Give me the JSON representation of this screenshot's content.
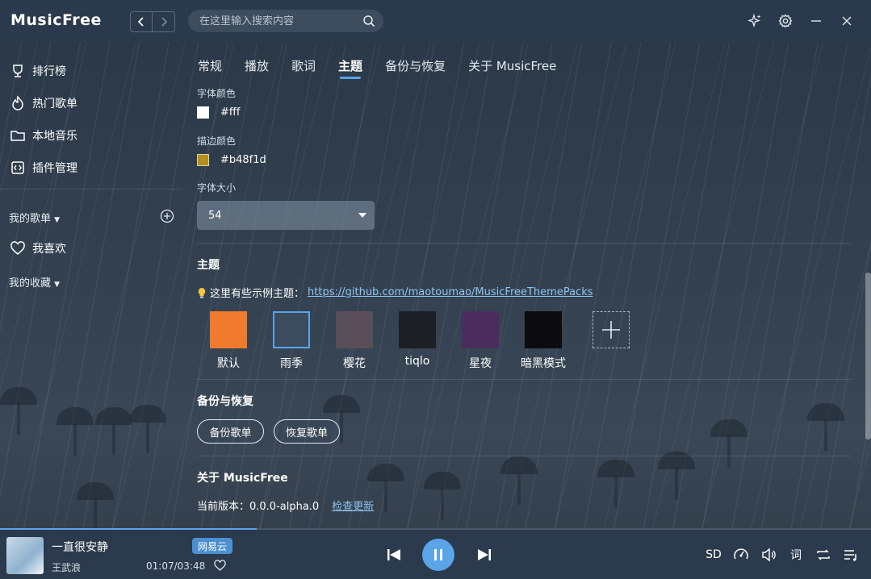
{
  "app": {
    "name": "MusicFree"
  },
  "search": {
    "placeholder": "在这里输入搜索内容"
  },
  "sidebar": {
    "items": [
      {
        "label": "排行榜",
        "icon": "trophy-icon"
      },
      {
        "label": "热门歌单",
        "icon": "fire-icon"
      },
      {
        "label": "本地音乐",
        "icon": "folder-icon"
      },
      {
        "label": "插件管理",
        "icon": "plugin-icon"
      }
    ],
    "my_sheets_label": "我的歌单",
    "favorite_label": "我喜欢",
    "collections_label": "我的收藏"
  },
  "tabs": [
    {
      "label": "常规"
    },
    {
      "label": "播放"
    },
    {
      "label": "歌词"
    },
    {
      "label": "主题",
      "active": true
    },
    {
      "label": "备份与恢复"
    },
    {
      "label": "关于 MusicFree"
    }
  ],
  "lyric": {
    "font_color_label": "字体颜色",
    "font_color_value": "#fff",
    "font_color_hex": "#ffffff",
    "stroke_color_label": "描边颜色",
    "stroke_color_value": "#b48f1d",
    "stroke_color_hex": "#b48f1d",
    "font_size_label": "字体大小",
    "font_size_value": "54"
  },
  "theme": {
    "title": "主题",
    "hint_prefix": "这里有些示例主题：",
    "hint_link": "https://github.com/maotoumao/MusicFreeThemePacks",
    "items": [
      {
        "name": "默认",
        "color": "#f17a2c"
      },
      {
        "name": "雨季",
        "color": "#3b4c5e",
        "selected": true
      },
      {
        "name": "樱花",
        "color": "#5a4f58"
      },
      {
        "name": "tiqlo",
        "color": "#1c1f24"
      },
      {
        "name": "星夜",
        "color": "#4b2c5c"
      },
      {
        "name": "暗黑模式",
        "color": "#0c0c0e"
      }
    ]
  },
  "backup": {
    "title": "备份与恢复",
    "backup_btn": "备份歌单",
    "restore_btn": "恢复歌单"
  },
  "about": {
    "title": "关于 MusicFree",
    "version_label": "当前版本：0.0.0-alpha.0",
    "check_update": "检查更新"
  },
  "player": {
    "title": "一直很安静",
    "artist": "王武浪",
    "source": "网易云",
    "time": "01:07/03:48",
    "progress": 0.295,
    "quality": "SD",
    "lyric_btn": "词"
  },
  "colors": {
    "accent": "#5ba4e8",
    "titlebar": "#2a3a4c"
  }
}
